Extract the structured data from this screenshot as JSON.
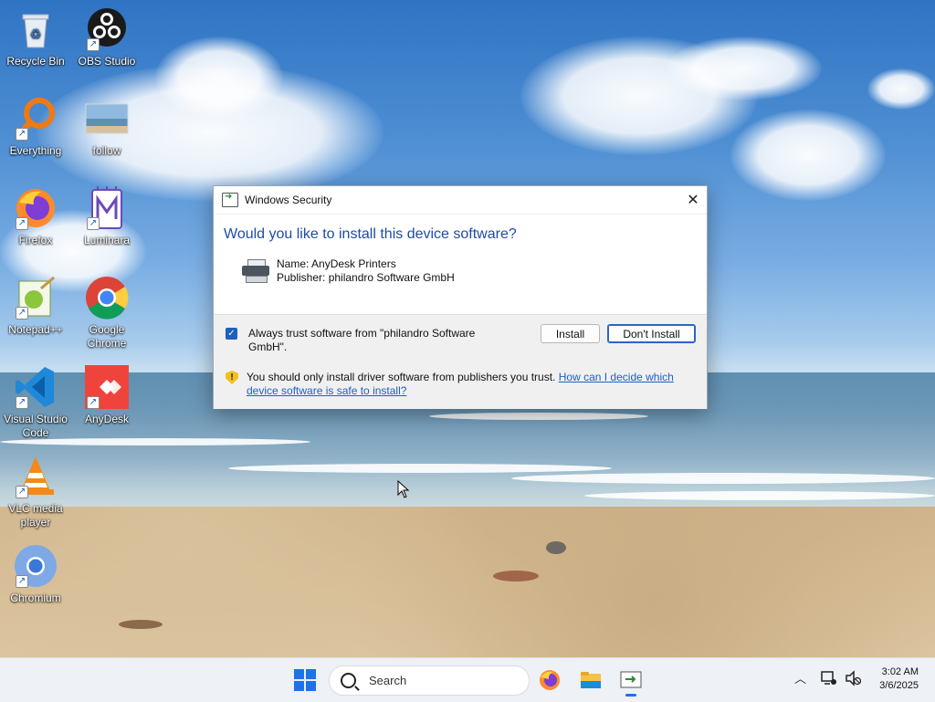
{
  "desktop": {
    "icons": [
      {
        "label": "Recycle Bin",
        "icon": "recycle-bin-icon"
      },
      {
        "label": "OBS Studio",
        "icon": "obs-studio-icon"
      },
      {
        "label": "Everything",
        "icon": "everything-search-icon"
      },
      {
        "label": "follow",
        "icon": "image-file-icon"
      },
      {
        "label": "Firefox",
        "icon": "firefox-icon"
      },
      {
        "label": "Luminara",
        "icon": "luminara-icon"
      },
      {
        "label": "Notepad++",
        "icon": "notepad-plus-plus-icon"
      },
      {
        "label": "Google Chrome",
        "icon": "chrome-icon"
      },
      {
        "label": "Visual Studio Code",
        "icon": "vscode-icon"
      },
      {
        "label": "AnyDesk",
        "icon": "anydesk-icon"
      },
      {
        "label": "VLC media player",
        "icon": "vlc-icon"
      },
      {
        "label": "Chromium",
        "icon": "chromium-icon"
      }
    ]
  },
  "dialog": {
    "title": "Windows Security",
    "heading": "Would you like to install this device software?",
    "device_name": "Name: AnyDesk Printers",
    "publisher": "Publisher: philandro Software GmbH",
    "trust_label": "Always trust software from \"philandro Software GmbH\".",
    "trust_checked": true,
    "install_label": "Install",
    "dont_install_label": "Don't Install",
    "warning_text": "You should only install driver software from publishers you trust.",
    "help_link": "How can I decide which device software is safe to install?"
  },
  "taskbar": {
    "search_placeholder": "Search",
    "pinned": [
      "firefox-icon",
      "file-explorer-icon",
      "windows-security-icon"
    ],
    "time": "3:02 AM",
    "date": "3/6/2025"
  },
  "colors": {
    "accent": "#1f5fbf",
    "heading": "#1e4ba7",
    "link": "#1e5fc4",
    "warning": "#f2c01e"
  }
}
